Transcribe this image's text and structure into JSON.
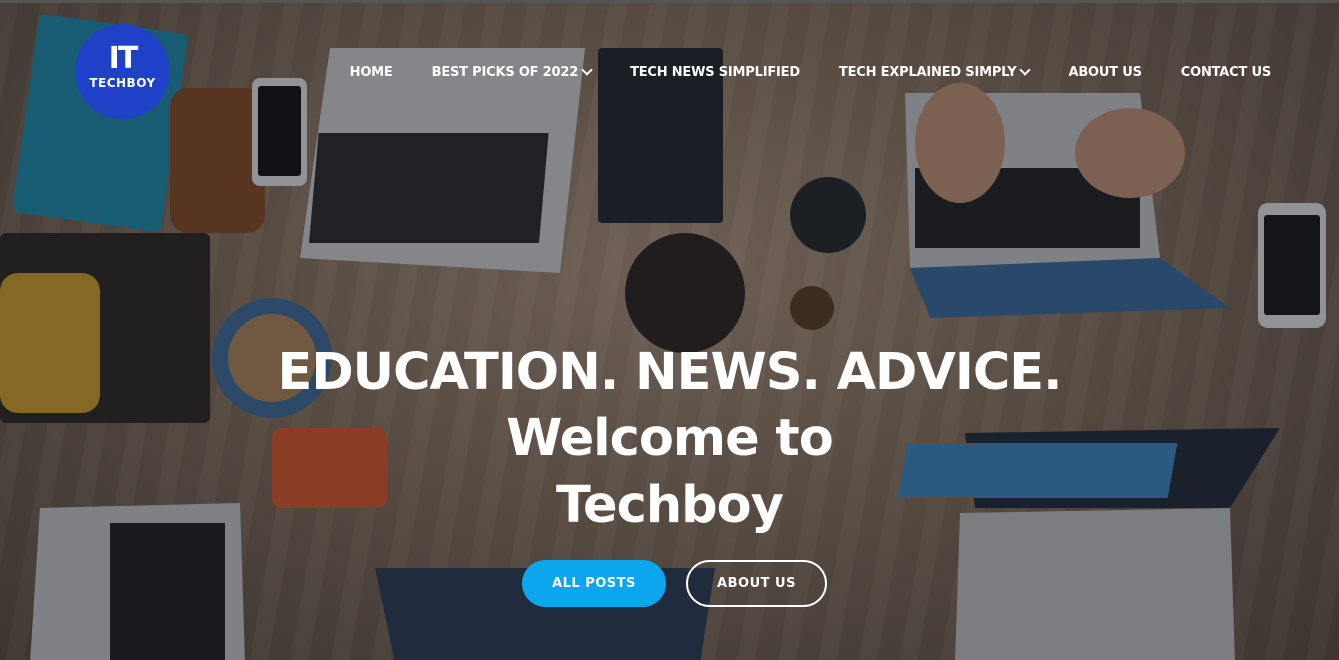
{
  "brand": {
    "logo_mark": "IT",
    "logo_text": "TECHBOY",
    "color": "#1f41c8"
  },
  "nav": {
    "items": [
      {
        "label": "HOME",
        "has_dropdown": false
      },
      {
        "label": "BEST PICKS OF 2022",
        "has_dropdown": true
      },
      {
        "label": "TECH NEWS SIMPLIFIED",
        "has_dropdown": false
      },
      {
        "label": "TECH EXPLAINED SIMPLY",
        "has_dropdown": true
      },
      {
        "label": "ABOUT US",
        "has_dropdown": false
      },
      {
        "label": "CONTACT US",
        "has_dropdown": false
      }
    ]
  },
  "hero": {
    "line1": "EDUCATION. NEWS. ADVICE.",
    "line2": "Welcome to",
    "line3": "Techboy",
    "primary_button": "ALL POSTS",
    "secondary_button": "ABOUT US",
    "accent_color": "#0ca6ef"
  }
}
